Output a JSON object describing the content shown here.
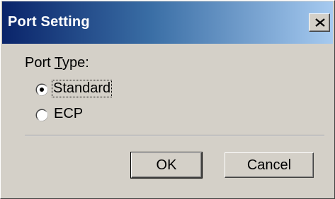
{
  "dialog": {
    "title": "Port Setting"
  },
  "port_type": {
    "label_prefix": "Port ",
    "label_accel": "T",
    "label_suffix": "ype:",
    "options": [
      {
        "label": "Standard",
        "selected": true
      },
      {
        "label": "ECP",
        "selected": false
      }
    ]
  },
  "buttons": {
    "ok_label": "OK",
    "cancel_label": "Cancel"
  },
  "icons": {
    "close": "close-icon",
    "radio_selected": "radio-selected-icon",
    "radio_unselected": "radio-unselected-icon"
  },
  "colors": {
    "title_gradient_start": "#0a246a",
    "title_gradient_end": "#a6caf0",
    "face": "#d4d0c8"
  }
}
